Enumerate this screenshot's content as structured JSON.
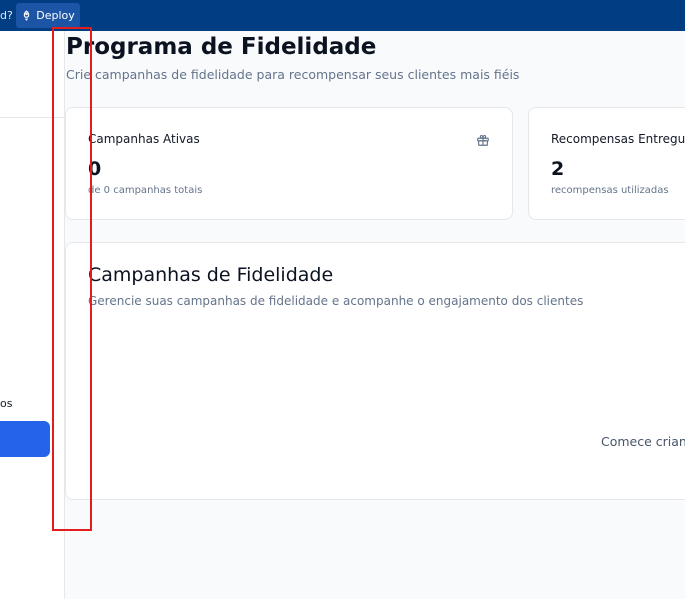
{
  "topbar": {
    "cut_text": "d?",
    "deploy_label": "Deploy"
  },
  "sidebar": {
    "cut_label": "os"
  },
  "header": {
    "title": "Programa de Fidelidade",
    "subtitle": "Crie campanhas de fidelidade para recompensar seus clientes mais fiéis"
  },
  "stats": [
    {
      "title": "Campanhas Ativas",
      "value": "0",
      "desc": "de 0 campanhas totais",
      "icon": "gift-icon"
    },
    {
      "title": "Recompensas Entregues",
      "value": "2",
      "desc": "recompensas utilizadas"
    }
  ],
  "campaigns": {
    "title": "Campanhas de Fidelidade",
    "subtitle": "Gerencie suas campanhas de fidelidade e acompanhe o engajamento dos clientes",
    "empty_text": "Comece criando"
  },
  "colors": {
    "topbar": "#003d82",
    "accent": "#2563eb",
    "highlight": "#e11d1d"
  }
}
